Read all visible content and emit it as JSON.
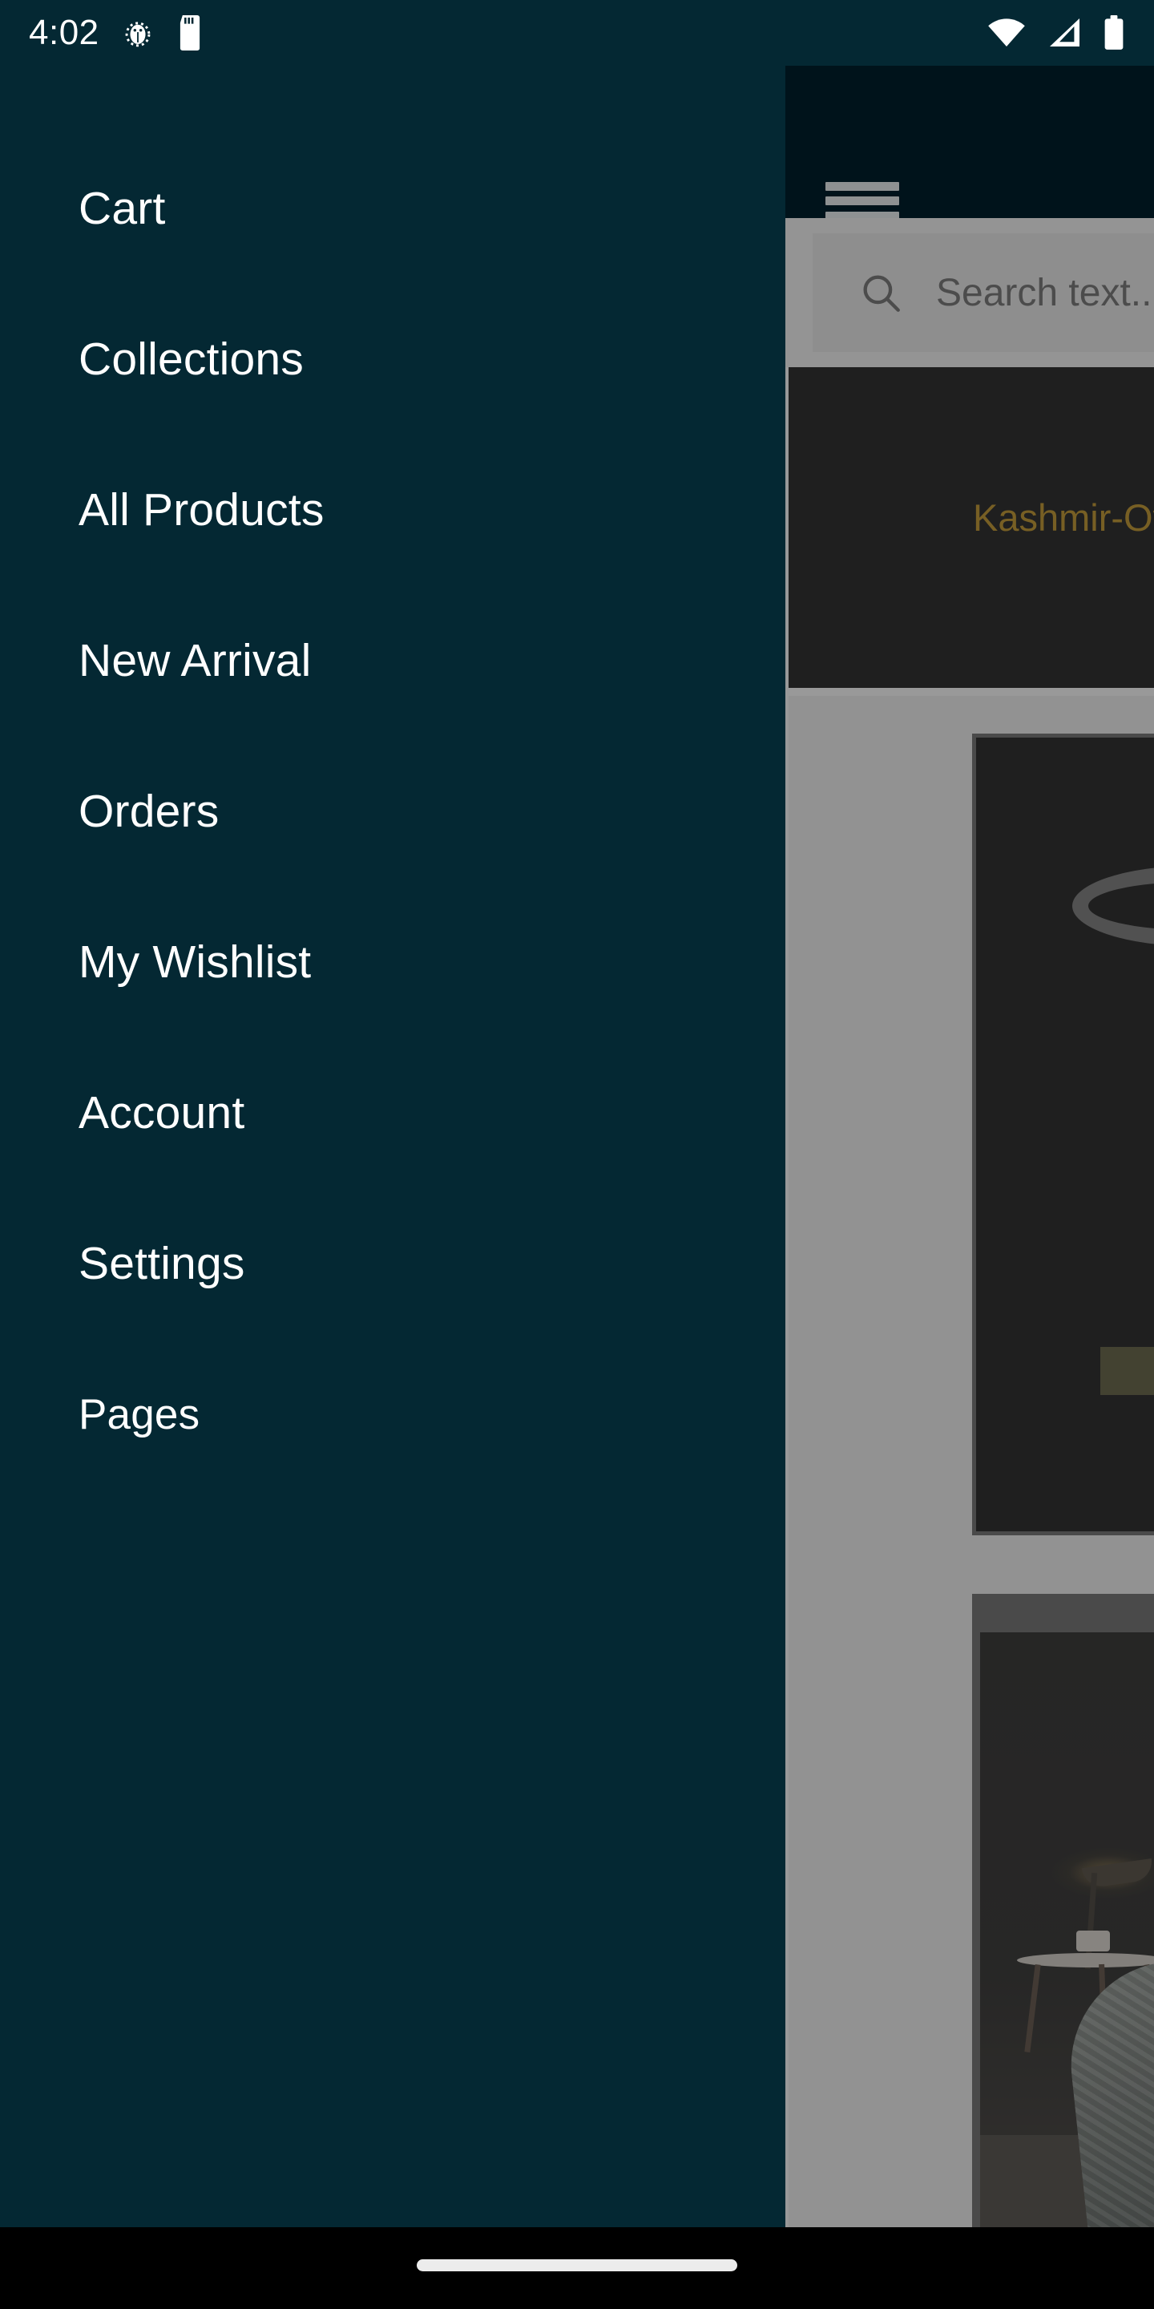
{
  "status_bar": {
    "time": "4:02",
    "left_icons": [
      "bug-icon",
      "sd-card-icon"
    ],
    "right_icons": [
      "wifi-icon",
      "cellular-signal-icon",
      "battery-icon"
    ],
    "background_color": "#042833"
  },
  "app_bar": {
    "menu_icon": "hamburger-menu-icon",
    "background_color": "#00131b"
  },
  "search": {
    "placeholder": "Search text....",
    "icon": "search-icon"
  },
  "banner": {
    "caption": "Kashmir-Ov",
    "caption_color": "#b8860b",
    "background_color": "#000000"
  },
  "drawer": {
    "background_color": "#042833",
    "text_color": "#ffffff",
    "items": [
      {
        "label": "Cart",
        "name": "cart"
      },
      {
        "label": "Collections",
        "name": "collections"
      },
      {
        "label": "All Products",
        "name": "all-products"
      },
      {
        "label": "New Arrival",
        "name": "new-arrival"
      },
      {
        "label": "Orders",
        "name": "orders"
      },
      {
        "label": "My Wishlist",
        "name": "my-wishlist"
      },
      {
        "label": "Account",
        "name": "account"
      },
      {
        "label": "Settings",
        "name": "settings"
      },
      {
        "label": "Pages",
        "name": "pages"
      }
    ]
  },
  "content": {
    "scrim_color": "#7a7a7a",
    "product_card_button_color": "#4d4a26"
  },
  "navigation_bar": {
    "home_indicator": "home-indicator-pill",
    "background_color": "#000000"
  }
}
